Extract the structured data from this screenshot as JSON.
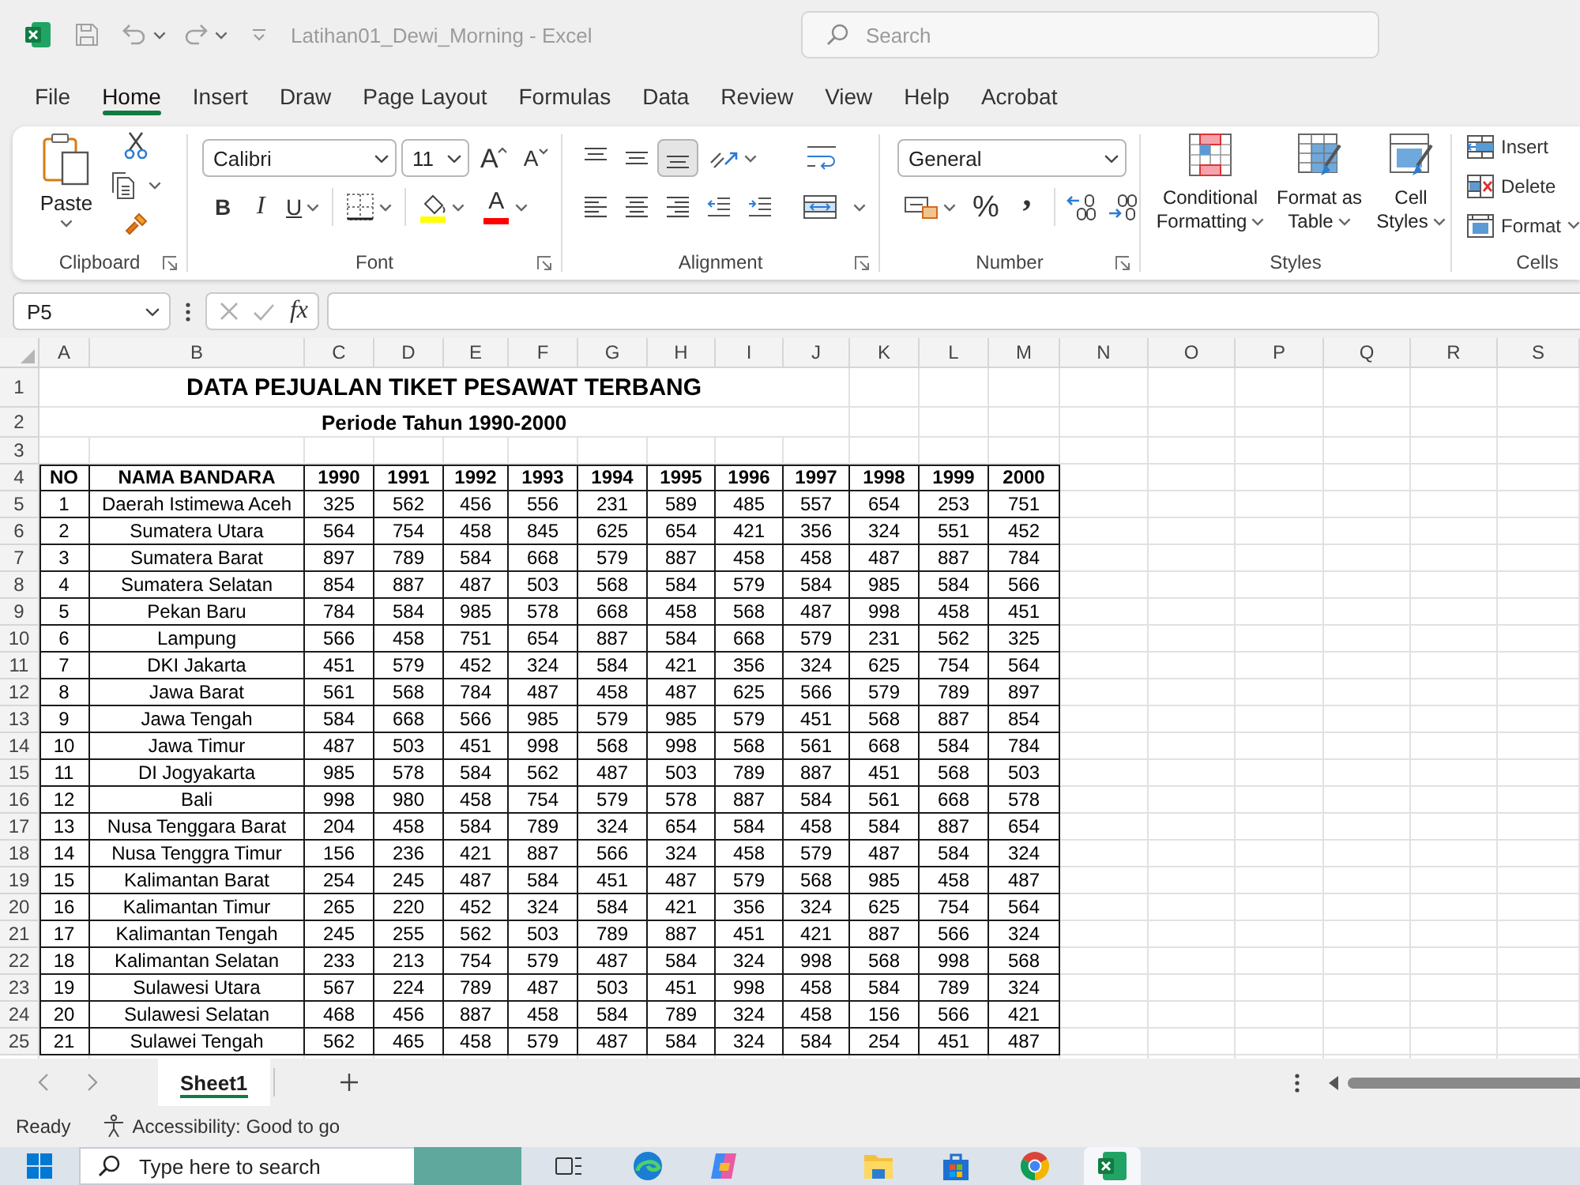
{
  "title_bar": {
    "title": "Latihan01_Dewi_Morning - Excel",
    "search": {
      "placeholder": "Search"
    }
  },
  "menu_tabs": [
    {
      "label": "File",
      "selected": false
    },
    {
      "label": "Home",
      "selected": true
    },
    {
      "label": "Insert",
      "selected": false
    },
    {
      "label": "Draw",
      "selected": false
    },
    {
      "label": "Page Layout",
      "selected": false
    },
    {
      "label": "Formulas",
      "selected": false
    },
    {
      "label": "Data",
      "selected": false
    },
    {
      "label": "Review",
      "selected": false
    },
    {
      "label": "View",
      "selected": false
    },
    {
      "label": "Help",
      "selected": false
    },
    {
      "label": "Acrobat",
      "selected": false
    }
  ],
  "ribbon": {
    "clipboard": {
      "paste": "Paste",
      "label": "Clipboard"
    },
    "font": {
      "font_name": "Calibri",
      "font_size": "11",
      "grow_font": "A",
      "shrink_font": "A",
      "bold": "B",
      "italic": "I",
      "underline": "U",
      "font_color": "A",
      "label": "Font"
    },
    "alignment": {
      "vertical": [
        {
          "kind": "top",
          "selected": false
        },
        {
          "kind": "middle",
          "selected": false
        },
        {
          "kind": "bottom",
          "selected": true
        }
      ],
      "horizontal": [
        {
          "kind": "left",
          "selected": false
        },
        {
          "kind": "center",
          "selected": false
        },
        {
          "kind": "right",
          "selected": false
        }
      ],
      "label": "Alignment"
    },
    "number": {
      "format": "General",
      "percent": "%",
      "comma": ",",
      "label": "Number"
    },
    "styles": {
      "buttons": [
        {
          "kind": "conditional",
          "lines": [
            "Conditional",
            "Formatting"
          ]
        },
        {
          "kind": "table",
          "lines": [
            "Format as",
            "Table"
          ]
        },
        {
          "kind": "cell",
          "lines": [
            "Cell",
            "Styles"
          ]
        }
      ],
      "label": "Styles"
    },
    "cells": {
      "buttons": [
        {
          "kind": "insert",
          "label": "Insert"
        },
        {
          "kind": "delete",
          "label": "Delete"
        },
        {
          "kind": "format",
          "label": "Format"
        }
      ],
      "label": "Cells"
    }
  },
  "formula_bar": {
    "name_box": "P5",
    "function_label": "fx"
  },
  "sheet": {
    "columns": [
      "A",
      "B",
      "C",
      "D",
      "E",
      "F",
      "G",
      "H",
      "I",
      "J",
      "K",
      "L",
      "M",
      "N",
      "O",
      "P",
      "Q",
      "R",
      "S"
    ],
    "row_numbers": [
      "1",
      "2",
      "3",
      "4",
      "5",
      "6",
      "7",
      "8",
      "9",
      "10",
      "11",
      "12",
      "13",
      "14",
      "15",
      "16",
      "17",
      "18",
      "19",
      "20",
      "21",
      "22",
      "23",
      "24",
      "25"
    ],
    "title": "DATA PEJUALAN TIKET PESAWAT TERBANG",
    "subtitle": "Periode Tahun 1990-2000",
    "table": {
      "header": [
        "NO",
        "NAMA BANDARA",
        "1990",
        "1991",
        "1992",
        "1993",
        "1994",
        "1995",
        "1996",
        "1997",
        "1998",
        "1999",
        "2000"
      ],
      "rows": [
        [
          "1",
          "Daerah Istimewa Aceh",
          "325",
          "562",
          "456",
          "556",
          "231",
          "589",
          "485",
          "557",
          "654",
          "253",
          "751"
        ],
        [
          "2",
          "Sumatera Utara",
          "564",
          "754",
          "458",
          "845",
          "625",
          "654",
          "421",
          "356",
          "324",
          "551",
          "452"
        ],
        [
          "3",
          "Sumatera Barat",
          "897",
          "789",
          "584",
          "668",
          "579",
          "887",
          "458",
          "458",
          "487",
          "887",
          "784"
        ],
        [
          "4",
          "Sumatera Selatan",
          "854",
          "887",
          "487",
          "503",
          "568",
          "584",
          "579",
          "584",
          "985",
          "584",
          "566"
        ],
        [
          "5",
          "Pekan Baru",
          "784",
          "584",
          "985",
          "578",
          "668",
          "458",
          "568",
          "487",
          "998",
          "458",
          "451"
        ],
        [
          "6",
          "Lampung",
          "566",
          "458",
          "751",
          "654",
          "887",
          "584",
          "668",
          "579",
          "231",
          "562",
          "325"
        ],
        [
          "7",
          "DKI Jakarta",
          "451",
          "579",
          "452",
          "324",
          "584",
          "421",
          "356",
          "324",
          "625",
          "754",
          "564"
        ],
        [
          "8",
          "Jawa Barat",
          "561",
          "568",
          "784",
          "487",
          "458",
          "487",
          "625",
          "566",
          "579",
          "789",
          "897"
        ],
        [
          "9",
          "Jawa Tengah",
          "584",
          "668",
          "566",
          "985",
          "579",
          "985",
          "579",
          "451",
          "568",
          "887",
          "854"
        ],
        [
          "10",
          "Jawa Timur",
          "487",
          "503",
          "451",
          "998",
          "568",
          "998",
          "568",
          "561",
          "668",
          "584",
          "784"
        ],
        [
          "11",
          "DI Jogyakarta",
          "985",
          "578",
          "584",
          "562",
          "487",
          "503",
          "789",
          "887",
          "451",
          "568",
          "503"
        ],
        [
          "12",
          "Bali",
          "998",
          "980",
          "458",
          "754",
          "579",
          "578",
          "887",
          "584",
          "561",
          "668",
          "578"
        ],
        [
          "13",
          "Nusa Tenggara Barat",
          "204",
          "458",
          "584",
          "789",
          "324",
          "654",
          "584",
          "458",
          "584",
          "887",
          "654"
        ],
        [
          "14",
          "Nusa Tenggra Timur",
          "156",
          "236",
          "421",
          "887",
          "566",
          "324",
          "458",
          "579",
          "487",
          "584",
          "324"
        ],
        [
          "15",
          "Kalimantan Barat",
          "254",
          "245",
          "487",
          "584",
          "451",
          "487",
          "579",
          "568",
          "985",
          "458",
          "487"
        ],
        [
          "16",
          "Kalimantan Timur",
          "265",
          "220",
          "452",
          "324",
          "584",
          "421",
          "356",
          "324",
          "625",
          "754",
          "564"
        ],
        [
          "17",
          "Kalimantan Tengah",
          "245",
          "255",
          "562",
          "503",
          "789",
          "887",
          "451",
          "421",
          "887",
          "566",
          "324"
        ],
        [
          "18",
          "Kalimantan Selatan",
          "233",
          "213",
          "754",
          "579",
          "487",
          "584",
          "324",
          "998",
          "568",
          "998",
          "568"
        ],
        [
          "19",
          "Sulawesi Utara",
          "567",
          "224",
          "789",
          "487",
          "503",
          "451",
          "998",
          "458",
          "584",
          "789",
          "324"
        ],
        [
          "20",
          "Sulawesi Selatan",
          "468",
          "456",
          "887",
          "458",
          "584",
          "789",
          "324",
          "458",
          "156",
          "566",
          "421"
        ],
        [
          "21",
          "Sulawei Tengah",
          "562",
          "465",
          "458",
          "579",
          "487",
          "584",
          "324",
          "584",
          "254",
          "451",
          "487"
        ]
      ]
    }
  },
  "sheet_tabs": [
    {
      "label": "Sheet1",
      "selected": true
    }
  ],
  "status_bar": {
    "mode": "Ready",
    "accessibility": "Accessibility: Good to go"
  },
  "taskbar": {
    "search_placeholder": "Type here to search",
    "apps": [
      {
        "kind": "task_view",
        "selected": false
      },
      {
        "kind": "edge",
        "selected": false
      },
      {
        "kind": "copilot",
        "selected": false
      },
      {
        "kind": "explorer",
        "selected": false
      },
      {
        "kind": "store",
        "selected": false
      },
      {
        "kind": "chrome",
        "selected": false
      },
      {
        "kind": "excel",
        "selected": true
      }
    ]
  }
}
